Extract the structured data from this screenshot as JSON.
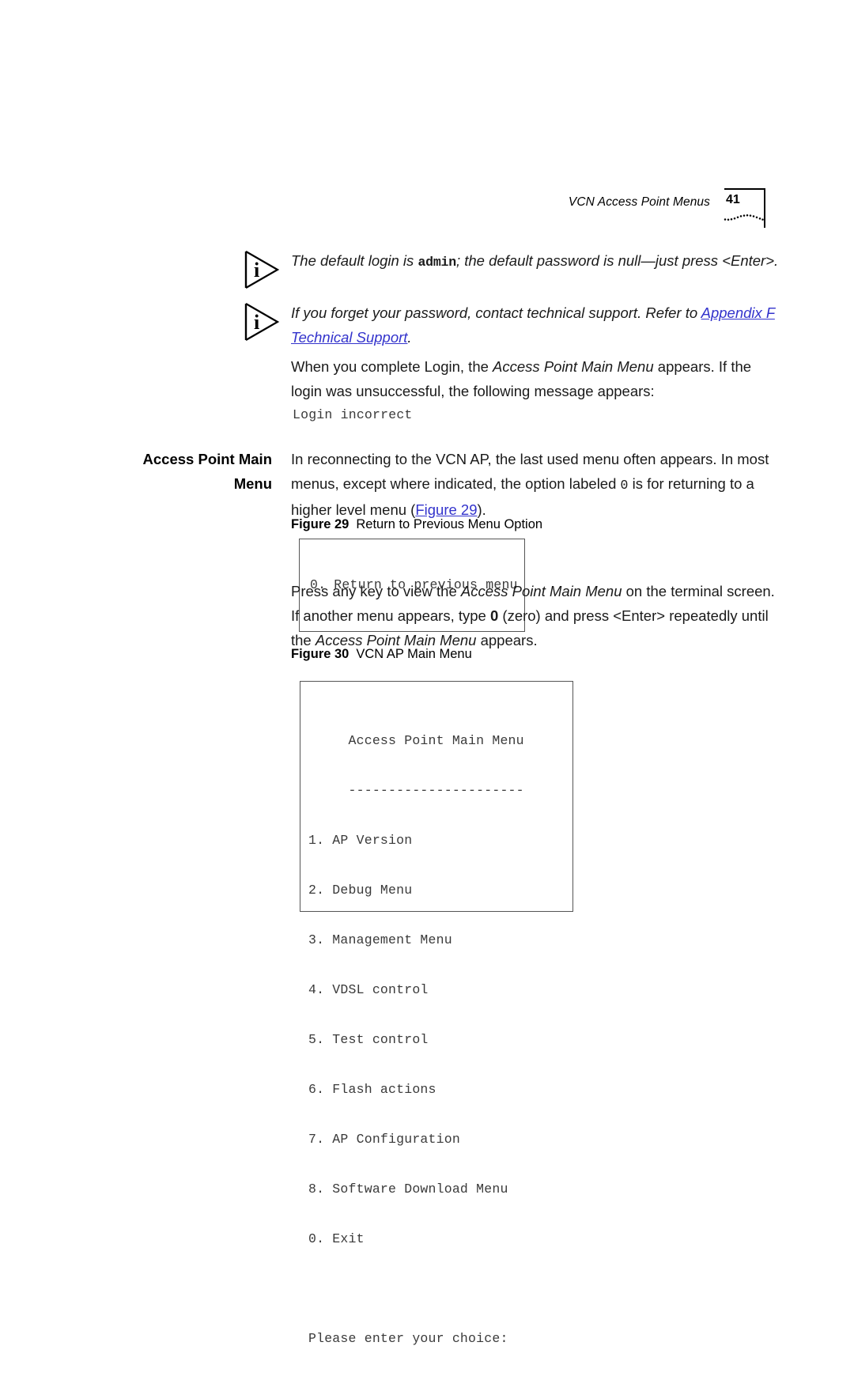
{
  "header": {
    "title": "VCN Access Point Menus",
    "page_number": "41"
  },
  "notes": [
    {
      "icon": "info-icon",
      "segments": [
        {
          "type": "text",
          "value": "The default login is "
        },
        {
          "type": "mono-bold",
          "value": "admin"
        },
        {
          "type": "text",
          "value": "; the default password is null—just press <Enter>."
        }
      ],
      "plain": "The default login is admin; the default password is null—just press <Enter>."
    },
    {
      "icon": "info-icon",
      "segments": [
        {
          "type": "text",
          "value": "If you forget your password, contact technical support. Refer to "
        },
        {
          "type": "link",
          "value": "Appendix F"
        },
        {
          "type": "text",
          "value": " "
        },
        {
          "type": "link",
          "value": "Technical Support"
        },
        {
          "type": "text",
          "value": "."
        }
      ],
      "plain": "If you forget your password, contact technical support. Refer to Appendix F Technical Support.",
      "link1": "Appendix F",
      "link2": "Technical Support"
    }
  ],
  "paragraphs": {
    "intro_1": "When you complete Login, the ",
    "intro_1_italic": "Access Point Main Menu",
    "intro_2": " appears. If the login was unsuccessful, the following message appears:",
    "login_error_sample": "Login incorrect",
    "reconnect_1": "In reconnecting to the VCN AP, the last used menu often appears. In most menus, except where indicated, the option labeled ",
    "reconnect_mono": "0",
    "reconnect_2": " is for returning to a higher level menu (",
    "reconnect_link": "Figure 29",
    "reconnect_3": ").",
    "press_key_1": "Press any key to view the ",
    "press_key_italic_1": "Access Point Main Menu",
    "press_key_2": " on the terminal screen. If another menu appears, type ",
    "press_key_bold": "0",
    "press_key_3": " (zero) and press <Enter> repeatedly until the ",
    "press_key_italic_2": "Access Point Main Menu",
    "press_key_4": " appears."
  },
  "side_heading": {
    "line1": "Access Point Main",
    "line2": "Menu",
    "full": "Access Point Main Menu"
  },
  "figures": [
    {
      "number": "Figure 29",
      "title": "Return to Previous Menu Option",
      "content_lines": [
        "0. Return to previous menu"
      ]
    },
    {
      "number": "Figure 30",
      "title": "VCN AP Main Menu",
      "content_lines": [
        "     Access Point Main Menu",
        "     ----------------------",
        "1. AP Version",
        "2. Debug Menu",
        "3. Management Menu",
        "4. VDSL control",
        "5. Test control",
        "6. Flash actions",
        "7. AP Configuration",
        "8. Software Download Menu",
        "0. Exit",
        "",
        "Please enter your choice:"
      ]
    }
  ],
  "colors": {
    "link": "#3333cc",
    "body_text": "#1a1a1a",
    "mono_text": "#3a3a3a",
    "box_border": "#555555"
  }
}
